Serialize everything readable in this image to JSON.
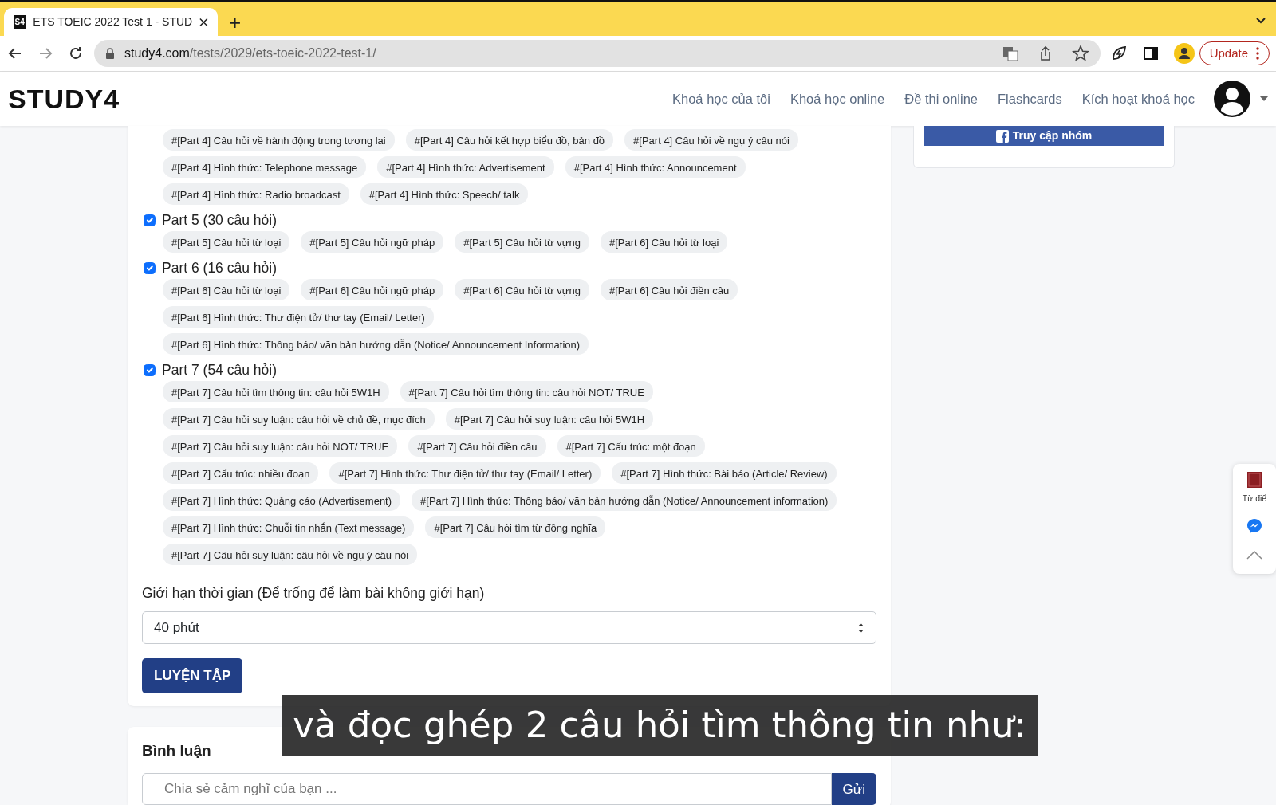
{
  "browser": {
    "tab": {
      "favicon": "S4",
      "title": "ETS TOEIC 2022 Test 1 - STUD",
      "selected": true
    },
    "new_tab": "+",
    "url": {
      "host": "study4.com",
      "path": "/tests/2029/ets-toeic-2022-test-1/"
    },
    "update_button": "Update"
  },
  "navbar": {
    "logo": "STUDY4",
    "links": [
      "Khoá học của tôi",
      "Khoá học online",
      "Đề thi online",
      "Flashcards",
      "Kích hoạt khoá học"
    ]
  },
  "parts": [
    {
      "tag_rows": [
        [
          "#[Part 4] Câu hỏi về hành động trong tương lai",
          "#[Part 4] Câu hỏi kết hợp biểu đồ, bản đồ",
          "#[Part 4] Câu hỏi về ngụ ý câu nói"
        ],
        [
          "#[Part 4] Hình thức: Telephone message",
          "#[Part 4] Hình thức: Advertisement",
          "#[Part 4] Hình thức: Announcement"
        ],
        [
          "#[Part 4] Hình thức: Radio broadcast",
          "#[Part 4] Hình thức: Speech/ talk"
        ]
      ]
    },
    {
      "label": "Part 5 (30 câu hỏi)",
      "checked": true,
      "tag_rows": [
        [
          "#[Part 5] Câu hỏi từ loại",
          "#[Part 5] Câu hỏi ngữ pháp",
          "#[Part 5] Câu hỏi từ vựng",
          "#[Part 6] Câu hỏi từ loại"
        ]
      ]
    },
    {
      "label": "Part 6 (16 câu hỏi)",
      "checked": true,
      "tag_rows": [
        [
          "#[Part 6] Câu hỏi từ loại",
          "#[Part 6] Câu hỏi ngữ pháp",
          "#[Part 6] Câu hỏi từ vựng",
          "#[Part 6] Câu hỏi điền câu"
        ],
        [
          "#[Part 6] Hình thức: Thư điện tử/ thư tay (Email/ Letter)"
        ],
        [
          "#[Part 6] Hình thức: Thông báo/ văn bản hướng dẫn (Notice/ Announcement Information)"
        ]
      ]
    },
    {
      "label": "Part 7 (54 câu hỏi)",
      "checked": true,
      "tag_rows": [
        [
          "#[Part 7] Câu hỏi tìm thông tin: câu hỏi 5W1H",
          "#[Part 7] Câu hỏi tìm thông tin: câu hỏi NOT/ TRUE"
        ],
        [
          "#[Part 7] Câu hỏi suy luận: câu hỏi về chủ đề, mục đích",
          "#[Part 7] Câu hỏi suy luận: câu hỏi 5W1H"
        ],
        [
          "#[Part 7] Câu hỏi suy luận: câu hỏi NOT/ TRUE",
          "#[Part 7] Câu hỏi điền câu",
          "#[Part 7] Cấu trúc: một đoạn"
        ],
        [
          "#[Part 7] Cấu trúc: nhiều đoạn",
          "#[Part 7] Hình thức: Thư điện tử/ thư tay (Email/ Letter)",
          "#[Part 7] Hình thức: Bài báo (Article/ Review)"
        ],
        [
          "#[Part 7] Hình thức: Quảng cáo (Advertisement)",
          "#[Part 7] Hình thức: Thông báo/ văn bản hướng dẫn (Notice/ Announcement information)"
        ],
        [
          "#[Part 7] Hình thức: Chuỗi tin nhắn (Text message)",
          "#[Part 7] Câu hỏi tìm từ đồng nghĩa"
        ],
        [
          "#[Part 7] Câu hỏi suy luận: câu hỏi về ngụ ý câu nói"
        ]
      ]
    }
  ],
  "time_limit": {
    "label": "Giới hạn thời gian (Để trống để làm bài không giới hạn)",
    "value": "40 phút"
  },
  "practice_button": "LUYỆN TẬP",
  "group_button": "Truy cập nhóm",
  "comments": {
    "title": "Bình luận",
    "placeholder": "Chia sẻ cảm nghĩ của bạn ...",
    "send": "Gửi"
  },
  "side_widget": {
    "dictionary_label": "Từ điể"
  },
  "caption": "và đọc ghép 2 câu hỏi tìm thông tin như:"
}
